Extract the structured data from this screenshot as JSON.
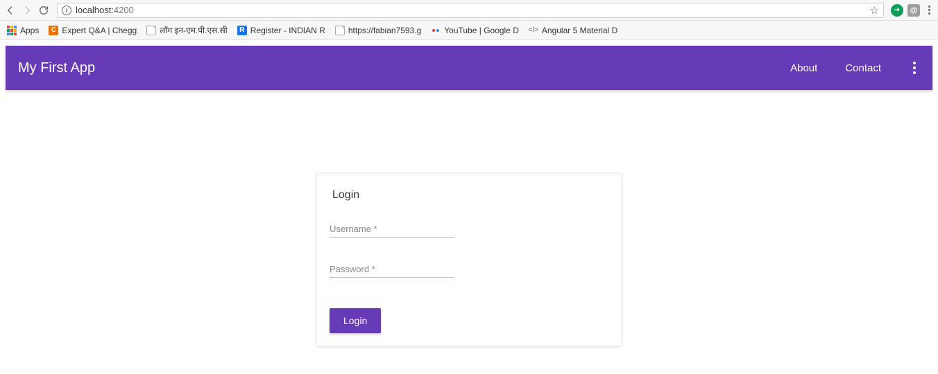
{
  "browser": {
    "url_host": "localhost:",
    "url_port": "4200",
    "bookmarks": [
      {
        "label": "Apps"
      },
      {
        "label": "Expert Q&A | Chegg"
      },
      {
        "label": "लॉग इन-एम.पी.एस.सी"
      },
      {
        "label": "Register - INDIAN R"
      },
      {
        "label": "https://fabian7593.g"
      },
      {
        "label": "YouTube  |  Google D"
      },
      {
        "label": "Angular 5 Material D"
      }
    ]
  },
  "appbar": {
    "title": "My First App",
    "links": [
      {
        "label": "About"
      },
      {
        "label": "Contact"
      }
    ]
  },
  "login": {
    "card_title": "Login",
    "username_placeholder": "Username *",
    "username_value": "",
    "password_placeholder": "Password *",
    "password_value": "",
    "submit_label": "Login"
  }
}
